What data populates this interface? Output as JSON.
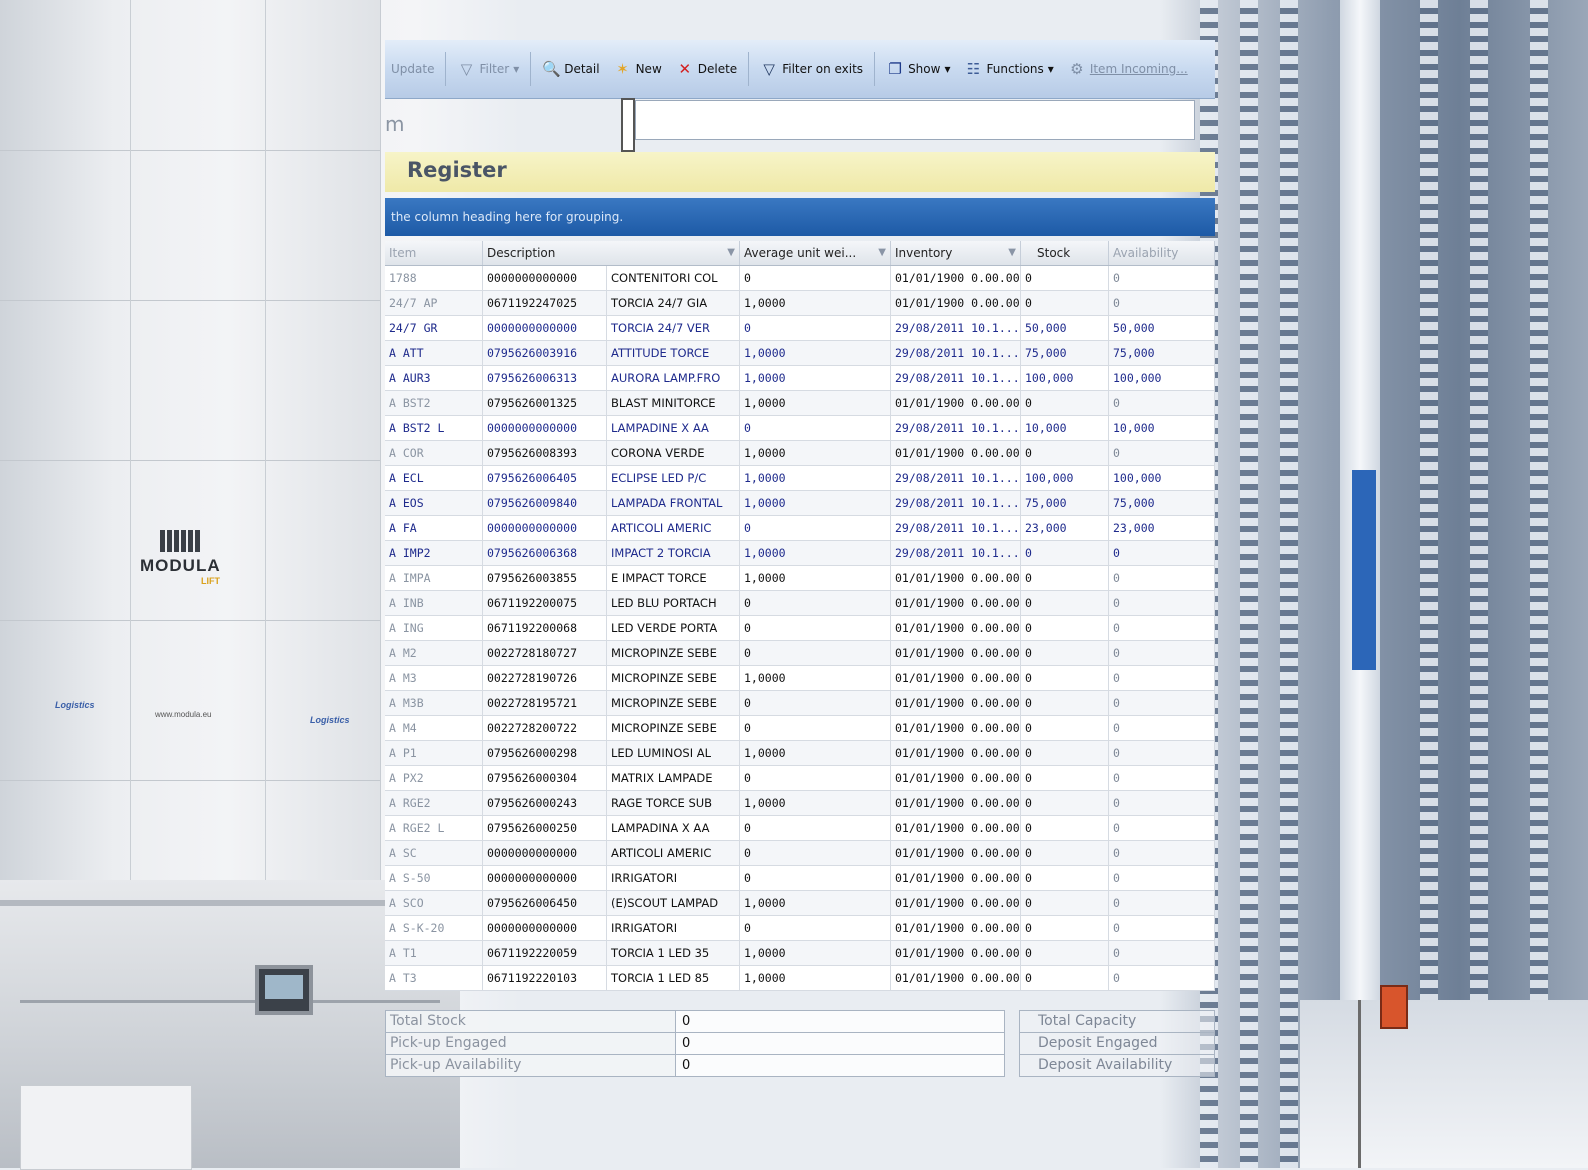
{
  "toolbar": {
    "update_label": "Update",
    "filter_label": "Filter",
    "detail_label": "Detail",
    "new_label": "New",
    "delete_label": "Delete",
    "filter_exits_label": "Filter on exits",
    "show_label": "Show",
    "functions_label": "Functions",
    "item_label": "Item Incoming..."
  },
  "search": {
    "label": "m",
    "value": ""
  },
  "page_title": "Register",
  "group_hint": "the column heading here for grouping.",
  "columns": [
    "Item",
    "Description",
    "",
    "Average unit wei...",
    "Inventory",
    "Stock",
    "Availability"
  ],
  "rows": [
    {
      "code": "1788",
      "barcode": "0000000000000",
      "desc": "CONTENITORI COL",
      "weight": "0",
      "inventory": "01/01/1900 0.00.00",
      "stock": "0",
      "avail": "0",
      "hl": false
    },
    {
      "code": "24/7 AP",
      "barcode": "0671192247025",
      "desc": "TORCIA 24/7 GIA",
      "weight": "1,0000",
      "inventory": "01/01/1900 0.00.00",
      "stock": "0",
      "avail": "0",
      "hl": false
    },
    {
      "code": "24/7 GR",
      "barcode": "0000000000000",
      "desc": "TORCIA 24/7 VER",
      "weight": "0",
      "inventory": "29/08/2011 10.1...",
      "stock": "50,000",
      "avail": "50,000",
      "hl": true
    },
    {
      "code": "A ATT",
      "barcode": "0795626003916",
      "desc": "ATTITUDE TORCE",
      "weight": "1,0000",
      "inventory": "29/08/2011 10.1...",
      "stock": "75,000",
      "avail": "75,000",
      "hl": true
    },
    {
      "code": "A AUR3",
      "barcode": "0795626006313",
      "desc": "AURORA LAMP.FRO",
      "weight": "1,0000",
      "inventory": "29/08/2011 10.1...",
      "stock": "100,000",
      "avail": "100,000",
      "hl": true
    },
    {
      "code": "A BST2",
      "barcode": "0795626001325",
      "desc": "BLAST MINITORCE",
      "weight": "1,0000",
      "inventory": "01/01/1900 0.00.00",
      "stock": "0",
      "avail": "0",
      "hl": false
    },
    {
      "code": "A BST2 L",
      "barcode": "0000000000000",
      "desc": "LAMPADINE X AA",
      "weight": "0",
      "inventory": "29/08/2011 10.1...",
      "stock": "10,000",
      "avail": "10,000",
      "hl": true
    },
    {
      "code": "A COR",
      "barcode": "0795626008393",
      "desc": "CORONA VERDE",
      "weight": "1,0000",
      "inventory": "01/01/1900 0.00.00",
      "stock": "0",
      "avail": "0",
      "hl": false
    },
    {
      "code": "A ECL",
      "barcode": "0795626006405",
      "desc": "ECLIPSE LED P/C",
      "weight": "1,0000",
      "inventory": "29/08/2011 10.1...",
      "stock": "100,000",
      "avail": "100,000",
      "hl": true
    },
    {
      "code": "A EOS",
      "barcode": "0795626009840",
      "desc": "LAMPADA FRONTAL",
      "weight": "1,0000",
      "inventory": "29/08/2011 10.1...",
      "stock": "75,000",
      "avail": "75,000",
      "hl": true
    },
    {
      "code": "A FA",
      "barcode": "0000000000000",
      "desc": "ARTICOLI AMERIC",
      "weight": "0",
      "inventory": "29/08/2011 10.1...",
      "stock": "23,000",
      "avail": "23,000",
      "hl": true
    },
    {
      "code": "A IMP2",
      "barcode": "0795626006368",
      "desc": "IMPACT 2 TORCIA",
      "weight": "1,0000",
      "inventory": "29/08/2011 10.1...",
      "stock": "0",
      "avail": "0",
      "hl": true
    },
    {
      "code": "A IMPA",
      "barcode": "0795626003855",
      "desc": "E IMPACT TORCE",
      "weight": "1,0000",
      "inventory": "01/01/1900 0.00.00",
      "stock": "0",
      "avail": "0",
      "hl": false
    },
    {
      "code": "A INB",
      "barcode": "0671192200075",
      "desc": "LED BLU PORTACH",
      "weight": "0",
      "inventory": "01/01/1900 0.00.00",
      "stock": "0",
      "avail": "0",
      "hl": false
    },
    {
      "code": "A ING",
      "barcode": "0671192200068",
      "desc": "LED VERDE PORTA",
      "weight": "0",
      "inventory": "01/01/1900 0.00.00",
      "stock": "0",
      "avail": "0",
      "hl": false
    },
    {
      "code": "A M2",
      "barcode": "0022728180727",
      "desc": "MICROPINZE SEBE",
      "weight": "0",
      "inventory": "01/01/1900 0.00.00",
      "stock": "0",
      "avail": "0",
      "hl": false
    },
    {
      "code": "A M3",
      "barcode": "0022728190726",
      "desc": "MICROPINZE SEBE",
      "weight": "1,0000",
      "inventory": "01/01/1900 0.00.00",
      "stock": "0",
      "avail": "0",
      "hl": false
    },
    {
      "code": "A M3B",
      "barcode": "0022728195721",
      "desc": "MICROPINZE SEBE",
      "weight": "0",
      "inventory": "01/01/1900 0.00.00",
      "stock": "0",
      "avail": "0",
      "hl": false
    },
    {
      "code": "A M4",
      "barcode": "0022728200722",
      "desc": "MICROPINZE SEBE",
      "weight": "0",
      "inventory": "01/01/1900 0.00.00",
      "stock": "0",
      "avail": "0",
      "hl": false
    },
    {
      "code": "A P1",
      "barcode": "0795626000298",
      "desc": "LED LUMINOSI AL",
      "weight": "1,0000",
      "inventory": "01/01/1900 0.00.00",
      "stock": "0",
      "avail": "0",
      "hl": false
    },
    {
      "code": "A PX2",
      "barcode": "0795626000304",
      "desc": "MATRIX LAMPADE",
      "weight": "0",
      "inventory": "01/01/1900 0.00.00",
      "stock": "0",
      "avail": "0",
      "hl": false
    },
    {
      "code": "A RGE2",
      "barcode": "0795626000243",
      "desc": "RAGE TORCE SUB",
      "weight": "1,0000",
      "inventory": "01/01/1900 0.00.00",
      "stock": "0",
      "avail": "0",
      "hl": false
    },
    {
      "code": "A RGE2 L",
      "barcode": "0795626000250",
      "desc": "LAMPADINA X AA",
      "weight": "0",
      "inventory": "01/01/1900 0.00.00",
      "stock": "0",
      "avail": "0",
      "hl": false
    },
    {
      "code": "A SC",
      "barcode": "0000000000000",
      "desc": "ARTICOLI AMERIC",
      "weight": "0",
      "inventory": "01/01/1900 0.00.00",
      "stock": "0",
      "avail": "0",
      "hl": false
    },
    {
      "code": "A S-50",
      "barcode": "0000000000000",
      "desc": "IRRIGATORI",
      "weight": "0",
      "inventory": "01/01/1900 0.00.00",
      "stock": "0",
      "avail": "0",
      "hl": false
    },
    {
      "code": "A SCO",
      "barcode": "0795626006450",
      "desc": "(E)SCOUT LAMPAD",
      "weight": "1,0000",
      "inventory": "01/01/1900 0.00.00",
      "stock": "0",
      "avail": "0",
      "hl": false
    },
    {
      "code": "A S-K-20",
      "barcode": "0000000000000",
      "desc": "IRRIGATORI",
      "weight": "0",
      "inventory": "01/01/1900 0.00.00",
      "stock": "0",
      "avail": "0",
      "hl": false
    },
    {
      "code": "A T1",
      "barcode": "0671192220059",
      "desc": "TORCIA 1 LED 35",
      "weight": "1,0000",
      "inventory": "01/01/1900 0.00.00",
      "stock": "0",
      "avail": "0",
      "hl": false
    },
    {
      "code": "A T3",
      "barcode": "0671192220103",
      "desc": "TORCIA 1 LED 85",
      "weight": "1,0000",
      "inventory": "01/01/1900 0.00.00",
      "stock": "0",
      "avail": "0",
      "hl": false
    }
  ],
  "summary_left": [
    {
      "label": "Total Stock",
      "value": "0"
    },
    {
      "label": "Pick-up Engaged",
      "value": "0"
    },
    {
      "label": "Pick-up Availability",
      "value": "0"
    }
  ],
  "summary_right": [
    {
      "label": "Total Capacity"
    },
    {
      "label": "Deposit Engaged"
    },
    {
      "label": "Deposit Availability"
    }
  ],
  "brand": {
    "word": "MODULA",
    "sub": "LIFT",
    "logo": "Logistics",
    "url": "www.modula.eu"
  },
  "colors": {
    "accent_blue": "#1d5aa6",
    "title_yellow": "#efe9a8",
    "highlight_text": "#1e2a8c"
  }
}
